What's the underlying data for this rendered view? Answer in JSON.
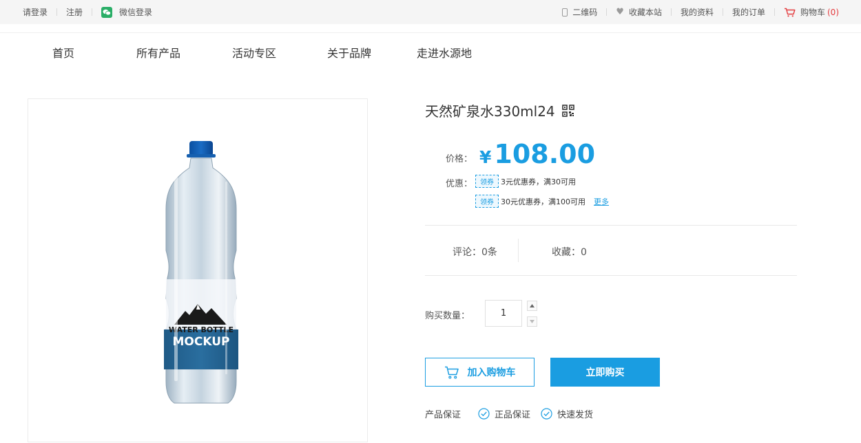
{
  "topbar": {
    "login": "请登录",
    "register": "注册",
    "wechat_login": "微信登录",
    "qrcode": "二维码",
    "favorite_site": "收藏本站",
    "my_profile": "我的资料",
    "my_orders": "我的订单",
    "cart_label": "购物车",
    "cart_count": "(0)"
  },
  "nav": {
    "items": [
      "首页",
      "所有产品",
      "活动专区",
      "关于品牌",
      "走进水源地"
    ]
  },
  "product": {
    "title": "天然矿泉水330ml24",
    "image_text_line1": "WATER BOTTLE",
    "image_text_line2": "MOCKUP",
    "price_label": "价格：",
    "currency": "¥",
    "price": "108.00",
    "discount_label": "优惠：",
    "coupon_tag": "领券",
    "coupons": [
      {
        "text": "3元优惠券，满30可用"
      },
      {
        "text": "30元优惠券，满100可用"
      }
    ],
    "more": "更多",
    "reviews": "评论：0条",
    "favorites": "收藏：0",
    "quantity_label": "购买数量：",
    "quantity": "1",
    "add_to_cart": "加入购物车",
    "buy_now": "立即购买",
    "guarantee_label": "产品保证",
    "guarantees": [
      "正品保证",
      "快速发货"
    ]
  },
  "colors": {
    "accent": "#1a9de1",
    "wechat_green": "#2aae67",
    "cart_red": "#e4393c",
    "topbar_bg": "#f5f5f5"
  },
  "icons": [
    "wechat-icon",
    "phone-icon",
    "heart-icon",
    "cart-icon",
    "qrcode-icon",
    "check-circle-icon",
    "triangle-up-icon",
    "triangle-down-icon"
  ]
}
